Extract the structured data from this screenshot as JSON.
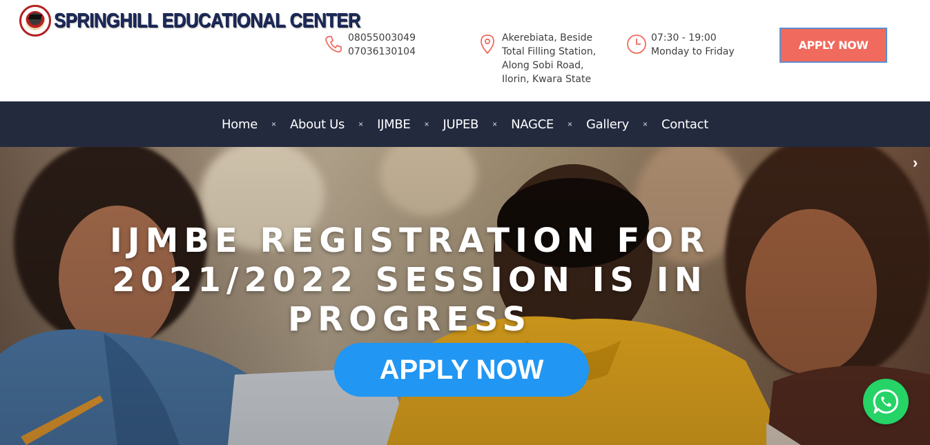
{
  "brand": {
    "name": "SPRINGHILL EDUCATIONAL CENTER",
    "logo_icon": "school-seal-icon"
  },
  "contact": {
    "phone_icon": "phone-icon",
    "phones": [
      "08055003049",
      "07036130104"
    ],
    "address_icon": "map-pin-icon",
    "address_lines": [
      "Akerebiata, Beside",
      "Total Filling Station,",
      "Along Sobi Road,",
      "Ilorin, Kwara State"
    ],
    "hours_icon": "clock-icon",
    "hours": "07:30 - 19:00",
    "days": "Monday to Friday"
  },
  "header": {
    "apply_label": "APPLY NOW"
  },
  "nav": {
    "separator": "×",
    "items": [
      "Home",
      "About Us",
      "IJMBE",
      "JUPEB",
      "NAGCE",
      "Gallery",
      "Contact"
    ]
  },
  "hero": {
    "title_line1": "IJMBE REGISTRATION FOR",
    "title_line2": "2021/2022 SESSION IS IN PROGRESS",
    "cta_label": "APPLY NOW",
    "next_arrow": "›"
  },
  "colors": {
    "accent": "#f06a5d",
    "nav_bg": "#232a3e",
    "cta_blue": "#2196f3",
    "whatsapp_green": "#25d366"
  },
  "widgets": {
    "whatsapp_icon": "whatsapp-icon"
  }
}
